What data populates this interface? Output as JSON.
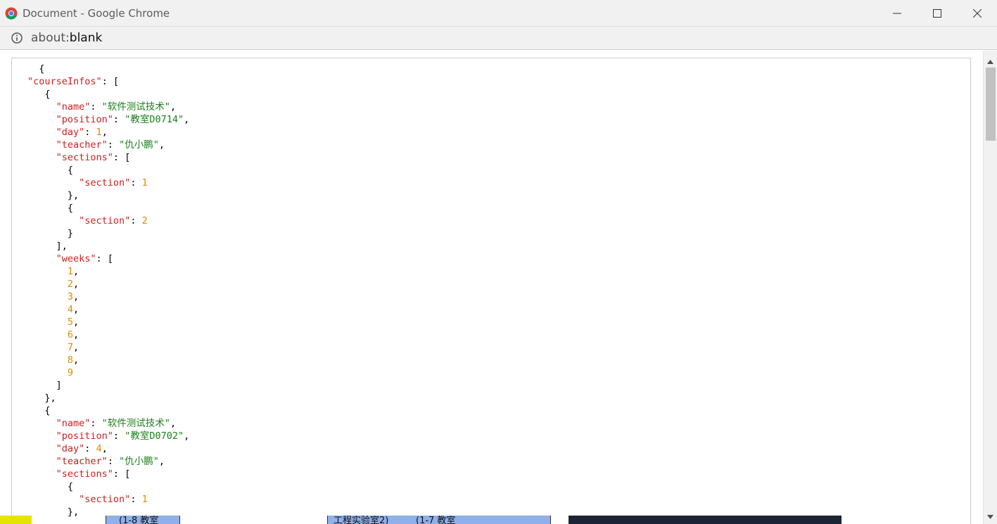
{
  "window": {
    "title": "Document - Google Chrome"
  },
  "addressbar": {
    "url_scheme": "about:",
    "url_host": "blank"
  },
  "json_lines": [
    [
      {
        "t": "p",
        "v": "  {"
      }
    ],
    [
      {
        "t": "k",
        "v": "\"courseInfos\""
      },
      {
        "t": "p",
        "v": ": ["
      }
    ],
    [
      {
        "t": "p",
        "v": "   {"
      }
    ],
    [
      {
        "t": "k",
        "v": "     \"name\""
      },
      {
        "t": "p",
        "v": ": "
      },
      {
        "t": "s",
        "v": "\"软件测试技术\""
      },
      {
        "t": "p",
        "v": ","
      }
    ],
    [
      {
        "t": "k",
        "v": "     \"position\""
      },
      {
        "t": "p",
        "v": ": "
      },
      {
        "t": "s",
        "v": "\"教室D0714\""
      },
      {
        "t": "p",
        "v": ","
      }
    ],
    [
      {
        "t": "k",
        "v": "     \"day\""
      },
      {
        "t": "p",
        "v": ": "
      },
      {
        "t": "n",
        "v": "1"
      },
      {
        "t": "p",
        "v": ","
      }
    ],
    [
      {
        "t": "k",
        "v": "     \"teacher\""
      },
      {
        "t": "p",
        "v": ": "
      },
      {
        "t": "s",
        "v": "\"仇小鹏\""
      },
      {
        "t": "p",
        "v": ","
      }
    ],
    [
      {
        "t": "k",
        "v": "     \"sections\""
      },
      {
        "t": "p",
        "v": ": ["
      }
    ],
    [
      {
        "t": "p",
        "v": "       {"
      }
    ],
    [
      {
        "t": "k",
        "v": "         \"section\""
      },
      {
        "t": "p",
        "v": ": "
      },
      {
        "t": "n",
        "v": "1"
      }
    ],
    [
      {
        "t": "p",
        "v": "       },"
      }
    ],
    [
      {
        "t": "p",
        "v": "       {"
      }
    ],
    [
      {
        "t": "k",
        "v": "         \"section\""
      },
      {
        "t": "p",
        "v": ": "
      },
      {
        "t": "n",
        "v": "2"
      }
    ],
    [
      {
        "t": "p",
        "v": "       }"
      }
    ],
    [
      {
        "t": "p",
        "v": "     ],"
      }
    ],
    [
      {
        "t": "k",
        "v": "     \"weeks\""
      },
      {
        "t": "p",
        "v": ": ["
      }
    ],
    [
      {
        "t": "n",
        "v": "       1"
      },
      {
        "t": "p",
        "v": ","
      }
    ],
    [
      {
        "t": "n",
        "v": "       2"
      },
      {
        "t": "p",
        "v": ","
      }
    ],
    [
      {
        "t": "n",
        "v": "       3"
      },
      {
        "t": "p",
        "v": ","
      }
    ],
    [
      {
        "t": "n",
        "v": "       4"
      },
      {
        "t": "p",
        "v": ","
      }
    ],
    [
      {
        "t": "n",
        "v": "       5"
      },
      {
        "t": "p",
        "v": ","
      }
    ],
    [
      {
        "t": "n",
        "v": "       6"
      },
      {
        "t": "p",
        "v": ","
      }
    ],
    [
      {
        "t": "n",
        "v": "       7"
      },
      {
        "t": "p",
        "v": ","
      }
    ],
    [
      {
        "t": "n",
        "v": "       8"
      },
      {
        "t": "p",
        "v": ","
      }
    ],
    [
      {
        "t": "n",
        "v": "       9"
      }
    ],
    [
      {
        "t": "p",
        "v": "     ]"
      }
    ],
    [
      {
        "t": "p",
        "v": "   },"
      }
    ],
    [
      {
        "t": "p",
        "v": "   {"
      }
    ],
    [
      {
        "t": "k",
        "v": "     \"name\""
      },
      {
        "t": "p",
        "v": ": "
      },
      {
        "t": "s",
        "v": "\"软件测试技术\""
      },
      {
        "t": "p",
        "v": ","
      }
    ],
    [
      {
        "t": "k",
        "v": "     \"position\""
      },
      {
        "t": "p",
        "v": ": "
      },
      {
        "t": "s",
        "v": "\"教室D0702\""
      },
      {
        "t": "p",
        "v": ","
      }
    ],
    [
      {
        "t": "k",
        "v": "     \"day\""
      },
      {
        "t": "p",
        "v": ": "
      },
      {
        "t": "n",
        "v": "4"
      },
      {
        "t": "p",
        "v": ","
      }
    ],
    [
      {
        "t": "k",
        "v": "     \"teacher\""
      },
      {
        "t": "p",
        "v": ": "
      },
      {
        "t": "s",
        "v": "\"仇小鹏\""
      },
      {
        "t": "p",
        "v": ","
      }
    ],
    [
      {
        "t": "k",
        "v": "     \"sections\""
      },
      {
        "t": "p",
        "v": ": ["
      }
    ],
    [
      {
        "t": "p",
        "v": "       {"
      }
    ],
    [
      {
        "t": "k",
        "v": "         \"section\""
      },
      {
        "t": "p",
        "v": ": "
      },
      {
        "t": "n",
        "v": "1"
      }
    ],
    [
      {
        "t": "p",
        "v": "       },"
      }
    ]
  ],
  "background_window": {
    "text_1": "(1-8 教室",
    "text_2": "工程实验室2)",
    "text_3": "(1-7 教室"
  },
  "colors": {
    "json_key": "#cc1f1f",
    "json_string": "#1a7f1a",
    "json_number": "#e08a00",
    "titlebar_bg": "#f1f1f1"
  },
  "icons": {
    "app": "chrome-logo-icon",
    "minimize": "minimize-icon",
    "maximize": "maximize-icon",
    "close": "close-icon",
    "site_info": "info-icon",
    "scroll_up": "scroll-up-arrow-icon",
    "scroll_down": "scroll-down-arrow-icon"
  }
}
